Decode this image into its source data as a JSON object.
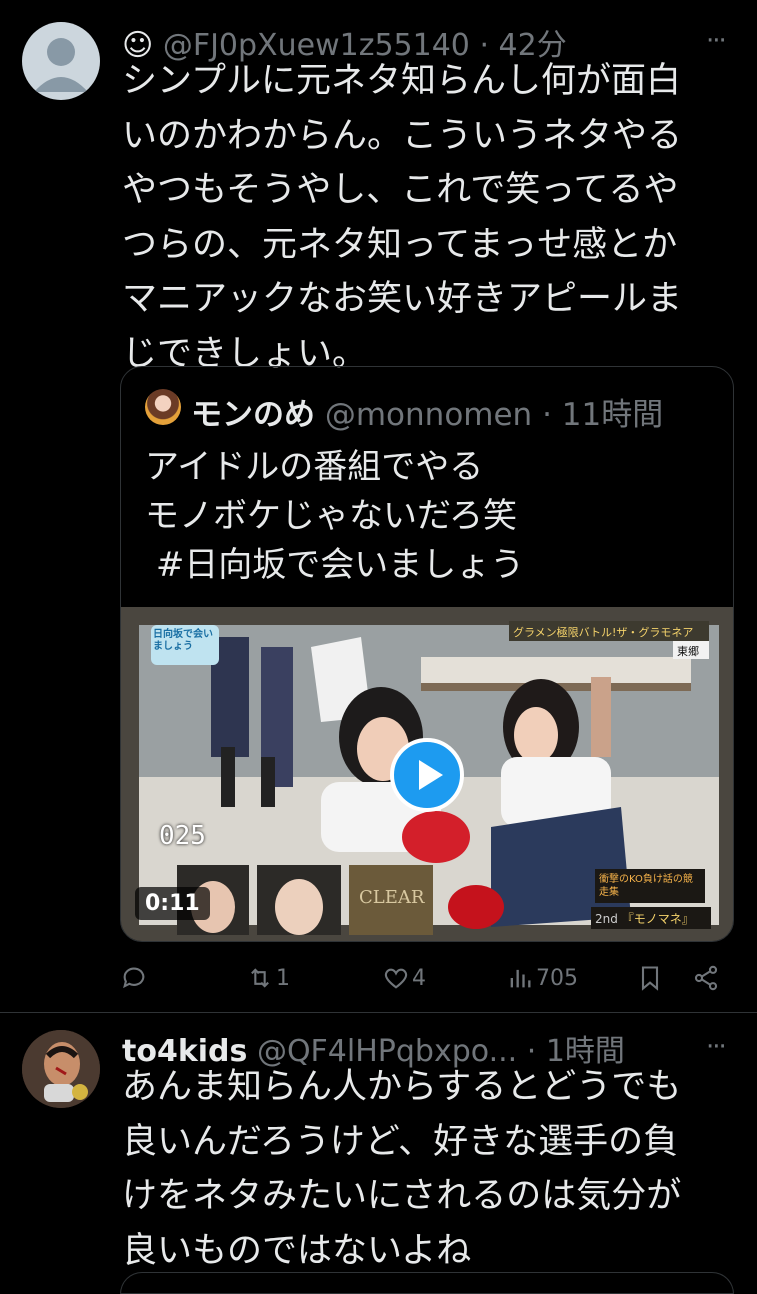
{
  "tweet1": {
    "emoji": "☺",
    "handle": "@FJ0pXuew1z55140",
    "sep": "·",
    "time": "42分",
    "more": "···",
    "text": "シンプルに元ネタ知らんし何が面白\nいのかわからん。こういうネタやる\nやつもそうやし、これで笑ってるや\nつらの、元ネタ知ってまっせ感とか\nマニアックなお笑い好きアピールま\nじできしょい。",
    "quote": {
      "name": "モンのめ",
      "handle": "@monnomen",
      "sep": "·",
      "time": "11時間",
      "text": "アイドルの番組でやる\nモノボケじゃないだろ笑\n #日向坂で会いましょう",
      "video": {
        "duration": "0:11",
        "counter": "025",
        "top_banner": "グラメン極限バトル!ザ・グラモネア",
        "side_tag": "東郷",
        "logo": "日向坂で会いましょう",
        "bottom_banner": "衝撃のKO負け話の競走集",
        "round": "2nd",
        "round_label": "『モノマネ』",
        "thumb_label": "CLEAR"
      }
    },
    "actions": {
      "replies": "",
      "retweets": "1",
      "likes": "4",
      "views": "705"
    }
  },
  "tweet2": {
    "name": "to4kids",
    "handle": "@QF4lHPqbxpo...",
    "sep": "·",
    "time": "1時間",
    "more": "···",
    "text": "あんま知らん人からするとどうでも\n良いんだろうけど、好きな選手の負\nけをネタみたいにされるのは気分が\n良いものではないよね"
  }
}
